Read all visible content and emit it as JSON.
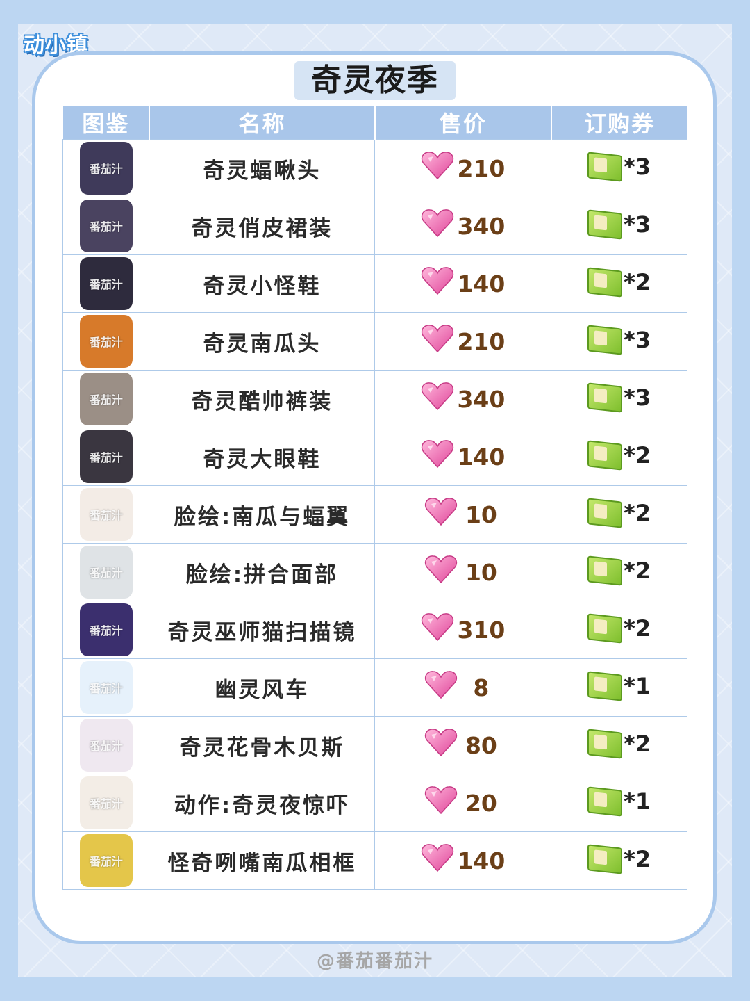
{
  "brand": {
    "logo_text": "动小镇"
  },
  "title": "奇灵夜季",
  "table": {
    "headers": [
      "图鉴",
      "名称",
      "售价",
      "订购券"
    ],
    "watermark": "番茄汁",
    "rows": [
      {
        "icon": "bat-hat-icon",
        "thumb_color": "#3f3a5a",
        "name": "奇灵蝠啾头",
        "price": "210",
        "ticket": "*3"
      },
      {
        "icon": "dress-icon",
        "thumb_color": "#4a4360",
        "name": "奇灵俏皮裙装",
        "price": "340",
        "ticket": "*3"
      },
      {
        "icon": "boots-icon",
        "thumb_color": "#2e2b3d",
        "name": "奇灵小怪鞋",
        "price": "140",
        "ticket": "*2"
      },
      {
        "icon": "pumpkin-head-icon",
        "thumb_color": "#d77a2a",
        "name": "奇灵南瓜头",
        "price": "210",
        "ticket": "*3"
      },
      {
        "icon": "suit-icon",
        "thumb_color": "#9b8f86",
        "name": "奇灵酷帅裤装",
        "price": "340",
        "ticket": "*3"
      },
      {
        "icon": "eye-shoes-icon",
        "thumb_color": "#3a3640",
        "name": "奇灵大眼鞋",
        "price": "140",
        "ticket": "*2"
      },
      {
        "icon": "face-paint-icon",
        "thumb_color": "#f3ece6",
        "name": "脸绘:南瓜与蝠翼",
        "price": "10",
        "ticket": "*2"
      },
      {
        "icon": "face-mask-icon",
        "thumb_color": "#dfe3e6",
        "name": "脸绘:拼合面部",
        "price": "10",
        "ticket": "*2"
      },
      {
        "icon": "cat-scanner-icon",
        "thumb_color": "#3b2f6e",
        "name": "奇灵巫师猫扫描镜",
        "price": "310",
        "ticket": "*2"
      },
      {
        "icon": "ghost-pinwheel-icon",
        "thumb_color": "#e6f1fb",
        "name": "幽灵风车",
        "price": "8",
        "ticket": "*1"
      },
      {
        "icon": "guitar-icon",
        "thumb_color": "#efe8f0",
        "name": "奇灵花骨木贝斯",
        "price": "80",
        "ticket": "*2"
      },
      {
        "icon": "scare-pose-icon",
        "thumb_color": "#f3ede6",
        "name": "动作:奇灵夜惊吓",
        "price": "20",
        "ticket": "*1"
      },
      {
        "icon": "pumpkin-frame-icon",
        "thumb_color": "#e4c64a",
        "name": "怪奇咧嘴南瓜相框",
        "price": "140",
        "ticket": "*2"
      }
    ]
  },
  "footer": "@番茄番茄汁"
}
